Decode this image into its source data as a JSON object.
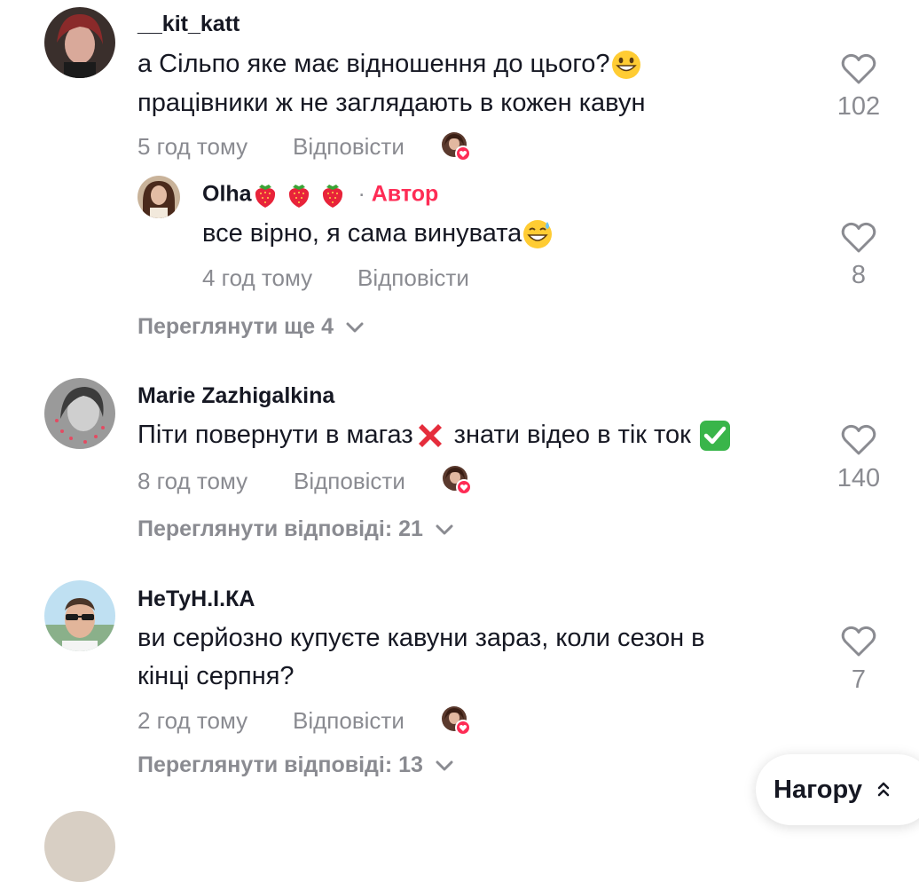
{
  "comments": [
    {
      "username": "__kit_katt",
      "text_line1": "а Сільпо яке має відношення до цього?",
      "text_line2": "працівники ж не заглядають в кожен кавун",
      "time": "5 год тому",
      "reply_label": "Відповісти",
      "likes": "102",
      "replies": [
        {
          "username": "Olha",
          "author_badge": "Автор",
          "text": "все вірно, я сама винувата",
          "time": "4 год тому",
          "reply_label": "Відповісти",
          "likes": "8"
        }
      ],
      "view_more": "Переглянути ще 4"
    },
    {
      "username": "Marie Zazhigalkina",
      "text_part1": "Піти повернути в магаз",
      "text_part2": " знати відео в тік ток ",
      "time": "8 год тому",
      "reply_label": "Відповісти",
      "likes": "140",
      "view_more": "Переглянути відповіді: 21"
    },
    {
      "username": "НеТуН.І.КА",
      "text_line1": "ви серйозно купуєте кавуни зараз, коли сезон в",
      "text_line2": "кінці серпня?",
      "time": "2 год тому",
      "reply_label": "Відповісти",
      "likes": "7",
      "view_more": "Переглянути відповіді: 13"
    }
  ],
  "to_top_label": "Нагору",
  "colors": {
    "accent": "#fe2c55",
    "muted": "#8a8b91",
    "text": "#161823"
  }
}
